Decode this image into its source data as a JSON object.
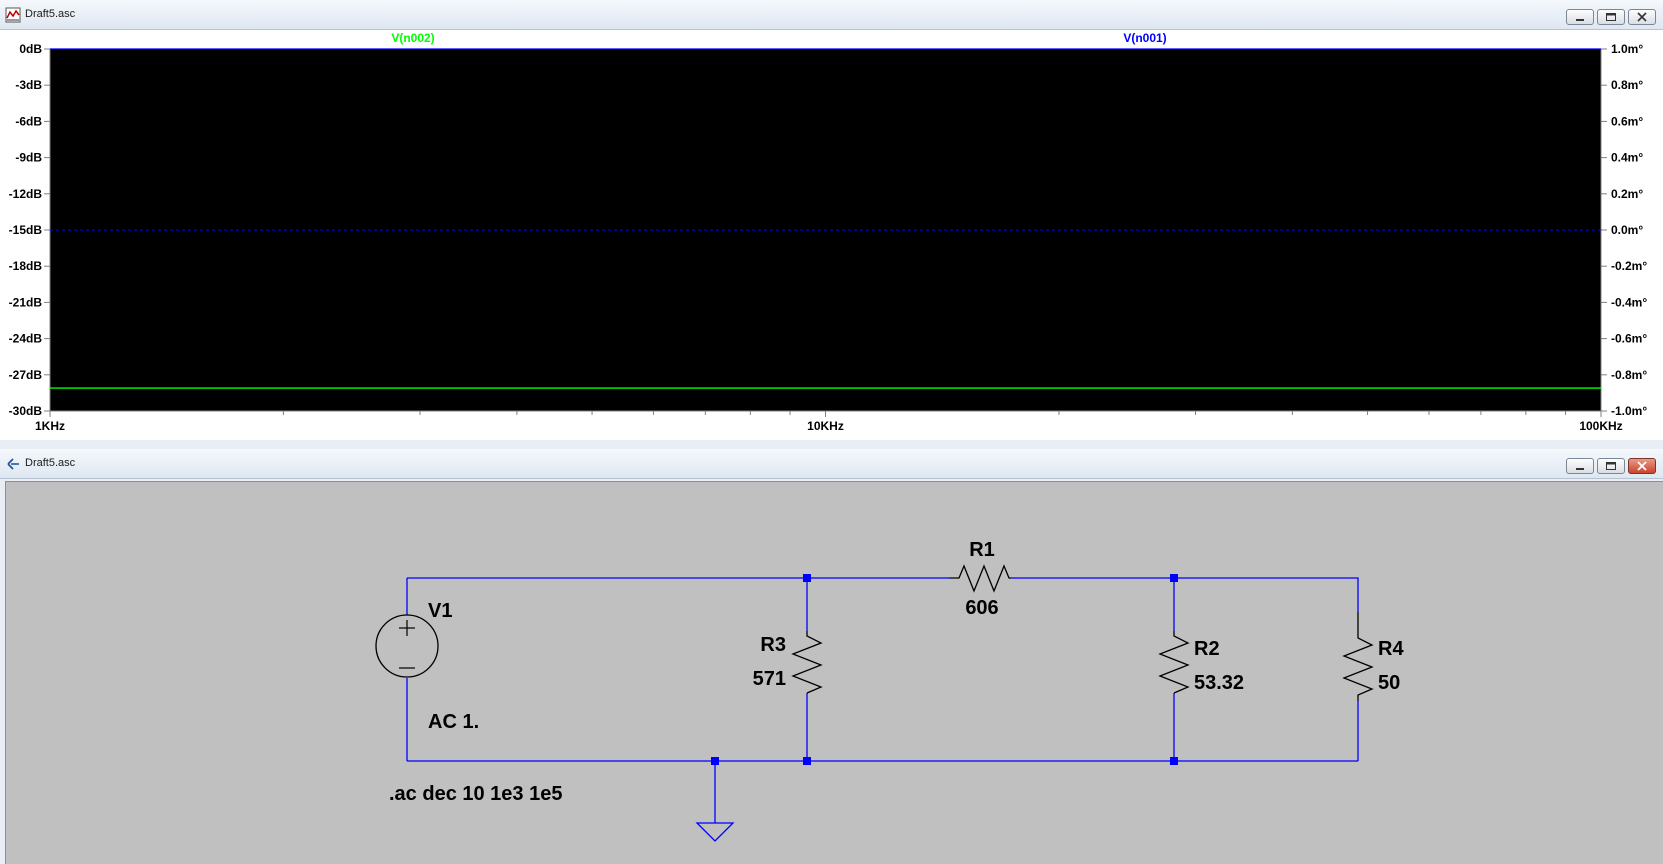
{
  "wave_window": {
    "title": "Draft5.asc",
    "icon": "waveform-icon",
    "controls": [
      "minimize-icon",
      "restore-icon",
      "close-icon"
    ]
  },
  "chart_data": {
    "type": "line",
    "x_scale": "log",
    "xlim": [
      1000,
      100000
    ],
    "x_tick_labels": [
      "1KHz",
      "10KHz",
      "100KHz"
    ],
    "y_left_tick_labels": [
      "0dB",
      "-3dB",
      "-6dB",
      "-9dB",
      "-12dB",
      "-15dB",
      "-18dB",
      "-21dB",
      "-24dB",
      "-27dB",
      "-30dB"
    ],
    "y_left_lim": [
      -30,
      0
    ],
    "y_right_tick_labels": [
      "1.0m°",
      "0.8m°",
      "0.6m°",
      "0.4m°",
      "0.2m°",
      "0.0m°",
      "-0.2m°",
      "-0.4m°",
      "-0.6m°",
      "-0.8m°",
      "-1.0m°"
    ],
    "y_right_lim": [
      -1.0,
      1.0
    ],
    "background": "#000000",
    "series": [
      {
        "name": "V(n002)",
        "color": "#00ff00",
        "magnitude_db": -28.1,
        "x": [
          1000,
          100000
        ],
        "y": [
          -28.1,
          -28.1
        ]
      },
      {
        "name": "V(n001)",
        "color": "#0000ff",
        "magnitude_db": 0,
        "phase_mdeg": 0,
        "x": [
          1000,
          100000
        ],
        "y": [
          0,
          0
        ]
      }
    ]
  },
  "schem_window": {
    "title": "Draft5.asc",
    "icon": "schematic-icon",
    "controls": [
      "minimize-icon",
      "restore-icon",
      "close-icon"
    ]
  },
  "schematic": {
    "wire_color": "#0000ff",
    "components": {
      "v1": {
        "name": "V1",
        "value": "AC 1."
      },
      "r1": {
        "name": "R1",
        "value": "606"
      },
      "r2": {
        "name": "R2",
        "value": "53.32"
      },
      "r3": {
        "name": "R3",
        "value": "571"
      },
      "r4": {
        "name": "R4",
        "value": "50"
      }
    },
    "directive": ".ac dec 10 1e3 1e5"
  }
}
